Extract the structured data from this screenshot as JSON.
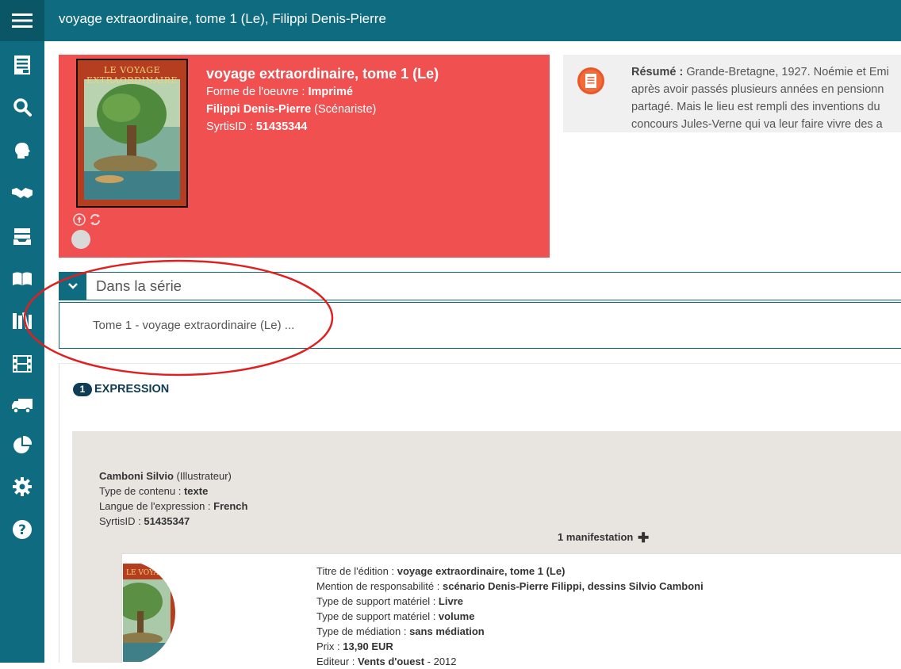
{
  "header": {
    "title": "voyage extraordinaire, tome 1 (Le), Filippi Denis-Pierre",
    "menu_icon": "hamburger-menu-icon"
  },
  "sidebar": {
    "items": [
      {
        "icon": "document-list-icon"
      },
      {
        "icon": "search-icon"
      },
      {
        "icon": "head-profile-icon"
      },
      {
        "icon": "handshake-icon"
      },
      {
        "icon": "inbox-stack-icon"
      },
      {
        "icon": "open-book-icon"
      },
      {
        "icon": "books-shelf-icon"
      },
      {
        "icon": "film-icon"
      },
      {
        "icon": "truck-icon"
      },
      {
        "icon": "pie-chart-icon"
      },
      {
        "icon": "gear-icon"
      },
      {
        "icon": "help-icon"
      }
    ]
  },
  "record": {
    "title": "voyage extraordinaire, tome 1 (Le)",
    "form_label": "Forme de l'oeuvre : ",
    "form_value": "Imprimé",
    "author_name": "Filippi Denis-Pierre",
    "author_role": " (Scénariste)",
    "syrtis_label": "SyrtisID : ",
    "syrtis_value": "51435344",
    "cover_title": "LE VOYAGE EXTRAORDINAIRE",
    "background_color": "#f05050"
  },
  "resume": {
    "label": "Résumé : ",
    "lines": [
      "Grande-Bretagne, 1927. Noémie et Emi",
      "après avoir passés plusieurs années en pensionn",
      "partagé. Mais le lieu est rempli des inventions du",
      "concours Jules-Verne qui va leur faire vivre des a"
    ]
  },
  "series": {
    "heading": "Dans la série",
    "item": "Tome 1 - voyage extraordinaire (Le) ..."
  },
  "expression": {
    "count_badge": "1",
    "heading": "EXPRESSION",
    "contributor_name": "Camboni Silvio",
    "contributor_role": " (Illustrateur)",
    "content_type_label": "Type de contenu : ",
    "content_type_value": "texte",
    "language_label": "Langue de l'expression : ",
    "language_value": "French",
    "syrtis_label": "SyrtisID : ",
    "syrtis_value": "51435347",
    "manifestation_count": "1 manifestation"
  },
  "manifestation": {
    "title_label": "Titre de l'édition : ",
    "title_value": "voyage extraordinaire, tome 1 (Le)",
    "resp_label": "Mention de responsabilité : ",
    "resp_value": "scénario Denis-Pierre Filippi,  dessins Silvio Camboni",
    "support1_label": "Type de support matériel : ",
    "support1_value": "Livre",
    "support2_label": "Type de support matériel : ",
    "support2_value": "volume",
    "mediation_label": "Type de médiation : ",
    "mediation_value": "sans médiation",
    "price_label": "Prix : ",
    "price_value": "13,90 EUR",
    "publisher_label": "Editeur : ",
    "publisher_value": "Vents d'ouest",
    "publisher_year": " - 2012"
  },
  "colors": {
    "primary": "#0f6b80",
    "annotation": "#e02020",
    "badge": "#0f3d55"
  }
}
